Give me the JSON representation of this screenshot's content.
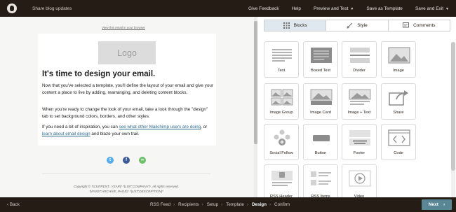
{
  "topbar": {
    "campaign_name": "Share blog updates",
    "nav": [
      "Give Feedback",
      "Help",
      "Preview and Test",
      "Save as Template",
      "Save and Exit"
    ]
  },
  "preview": {
    "view_in_browser": "View this email in your browser",
    "logo_text": "Logo",
    "heading": "It's time to design your email.",
    "paragraph1": "Now that you've selected a template, you'll define the layout of your email and give your content a place to live by adding, rearranging, and deleting content blocks.",
    "paragraph2": "When you're ready to change the look of your email, take a look through the \"design\" tab to set background colors, borders, and other styles.",
    "paragraph3_start": "If you need a bit of inspiration, you can ",
    "paragraph3_link1": "see what other Mailchimp users are doing",
    "paragraph3_mid": ", or ",
    "paragraph3_link2": "learn about email design",
    "paragraph3_end": " and blaze your own trail.",
    "footer_line1": "Copyright © *|CURRENT_YEAR|* *|LIST:COMPANY|*, All rights reserved.",
    "footer_line2": "*|IFNOT:ARCHIVE_PAGE|* *|LIST:DESCRIPTION|*"
  },
  "panel": {
    "tabs": [
      "Blocks",
      "Style",
      "Comments"
    ],
    "blocks": [
      "Text",
      "Boxed Text",
      "Divider",
      "Image",
      "Image Group",
      "Image Card",
      "Image + Text",
      "Share",
      "Social Follow",
      "Button",
      "Footer",
      "Code",
      "RSS Header",
      "RSS Items",
      "Video"
    ]
  },
  "bottombar": {
    "back": "Back",
    "steps": [
      "RSS Feed",
      "Recipients",
      "Setup",
      "Template",
      "Design",
      "Confirm"
    ],
    "current_step": "Design",
    "next": "Next"
  },
  "colors": {
    "topbar": "#241c15",
    "active_tab": "#dfe8ee",
    "next_button": "#5a8796",
    "link": "#2c6c8e"
  }
}
